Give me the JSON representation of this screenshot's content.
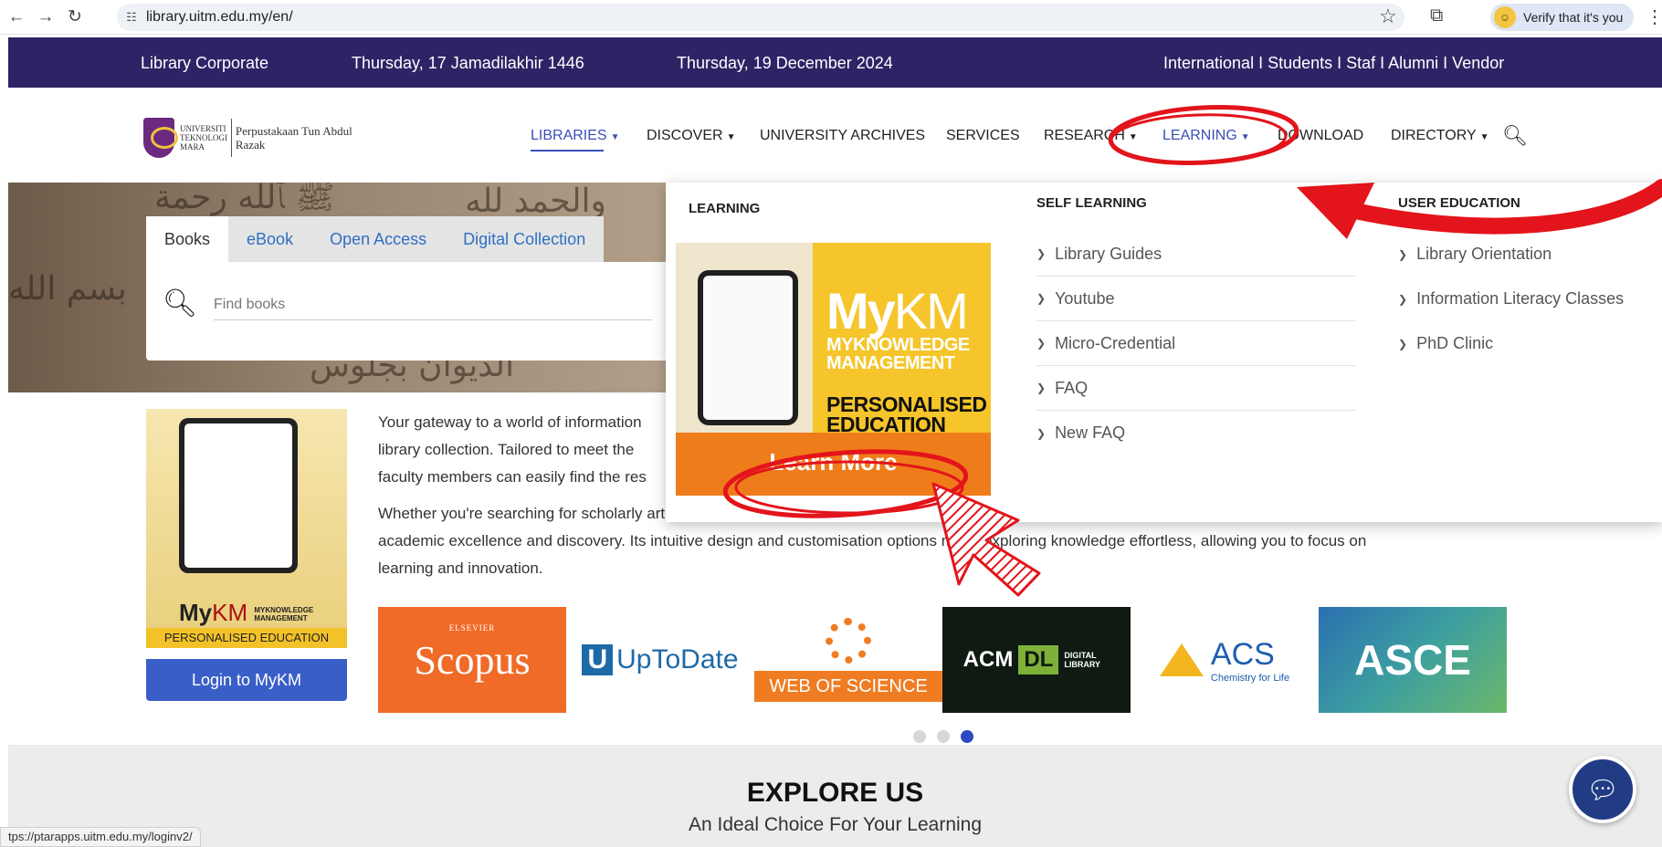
{
  "browser": {
    "url": "library.uitm.edu.my/en/",
    "verify_label": "Verify that it's you",
    "status_url": "tps://ptarapps.uitm.edu.my/loginv2/"
  },
  "topbar": {
    "corporate": "Library Corporate",
    "hijri_date": "Thursday, 17 Jamadilakhir 1446",
    "date": "Thursday, 19 December 2024",
    "audiences": "International I Students I Staf I Alumni I Vendor"
  },
  "logo": {
    "university": "UNIVERSITI TEKNOLOGI MARA",
    "library": "Perpustakaan Tun Abdul Razak"
  },
  "nav": {
    "libraries": "LIBRARIES",
    "discover": "DISCOVER",
    "archives": "UNIVERSITY ARCHIVES",
    "services": "SERVICES",
    "research": "RESEARCH",
    "learning": "LEARNING",
    "download": "DOWNLOAD",
    "directory": "DIRECTORY"
  },
  "search": {
    "tabs": [
      "Books",
      "eBook",
      "Open Access",
      "Digital Collection"
    ],
    "placeholder": "Find books"
  },
  "mykm_card": {
    "brand_my": "My",
    "brand_km": "KM",
    "brand_sub": "MYKNOWLEDGE MANAGEMENT",
    "tagline": "PERSONALISED EDUCATION",
    "login_label": "Login to MyKM"
  },
  "intro": {
    "p1_line1": "Your gateway to a world of information",
    "p1_line2": "library collection. Tailored to meet the",
    "p1_line3": "faculty members can easily find the res",
    "p2_line1": "Whether you're searching for scholarly articles, e-books, research datasets, or multimedia content, the portal serves as your one-stop destination for",
    "p2_line2": "academic excellence and discovery. Its intuitive design and customisation options make exploring knowledge effortless, allowing you to focus on",
    "p2_line3": "learning and innovation."
  },
  "databases": {
    "scopus": "Scopus",
    "scopus_pub": "ELSEVIER",
    "uptodate_u": "U",
    "uptodate": "UpToDate",
    "wos": "WEB OF SCIENCE",
    "acm": "ACM",
    "acm_dl": "DL",
    "acm_sub": "DIGITAL LIBRARY",
    "acs": "ACS",
    "acs_sub": "Chemistry for Life",
    "asce": "ASCE"
  },
  "explore": {
    "title": "EXPLORE US",
    "subtitle": "An Ideal Choice For Your Learning"
  },
  "mega_menu": {
    "learning_heading": "LEARNING",
    "promo_my": "My",
    "promo_km": "KM",
    "promo_line1": "MYKNOWLEDGE",
    "promo_line2": "MANAGEMENT",
    "promo_pe1": "PERSONALISED",
    "promo_pe2": "EDUCATION",
    "promo_cta": "Learn More",
    "self_heading": "SELF LEARNING",
    "self_items": [
      "Library Guides",
      "Youtube",
      "Micro-Credential",
      "FAQ",
      "New FAQ"
    ],
    "user_heading": "USER EDUCATION",
    "user_items": [
      "Library Orientation",
      "Information Literacy Classes",
      "PhD Clinic"
    ]
  },
  "colors": {
    "topbar": "#2d2466",
    "link": "#3a4fb8",
    "annotation": "#e3141b",
    "promo_orange": "#ef7c1a",
    "promo_yellow": "#f5c52b"
  }
}
